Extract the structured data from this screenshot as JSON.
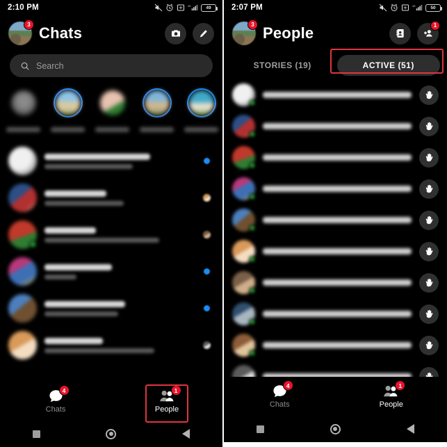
{
  "meta": {
    "accent_blue": "#1878f3",
    "badge_red": "#e8142a",
    "annotation_red": "#e0353f",
    "online_green": "#2ecc40",
    "background": "#000000"
  },
  "left_panel": {
    "status_bar": {
      "time": "2:10 PM",
      "battery_level": "49",
      "network": "4G",
      "icons": [
        "mute-icon",
        "alarm-icon",
        "screenshot-icon",
        "signal-icon",
        "battery-icon"
      ]
    },
    "header": {
      "title": "Chats",
      "avatar_badge": "3",
      "camera_label": "Camera",
      "compose_label": "New message"
    },
    "search": {
      "placeholder": "Search"
    },
    "stories": [
      {
        "name": "Your story",
        "has_ring": false
      },
      {
        "name": "Story 2",
        "has_ring": true
      },
      {
        "name": "Story 3",
        "has_ring": false
      },
      {
        "name": "Story 4",
        "has_ring": true
      },
      {
        "name": "Story 5",
        "has_ring": true
      }
    ],
    "chats": [
      {
        "avatar": "av-1",
        "online": false,
        "unread": true,
        "name_w": "72%",
        "msg_w": "60%"
      },
      {
        "avatar": "av-2",
        "online": false,
        "unread": false,
        "name_w": "42%",
        "msg_w": "54%"
      },
      {
        "avatar": "av-3",
        "online": true,
        "unread": false,
        "name_w": "35%",
        "msg_w": "78%"
      },
      {
        "avatar": "av-4",
        "online": false,
        "unread": true,
        "name_w": "46%",
        "msg_w": "22%"
      },
      {
        "avatar": "av-5",
        "online": false,
        "unread": true,
        "name_w": "55%",
        "msg_w": "50%"
      },
      {
        "avatar": "av-6",
        "online": false,
        "unread": false,
        "name_w": "40%",
        "msg_w": "75%"
      }
    ],
    "bottom_nav": [
      {
        "label": "Chats",
        "badge": "4",
        "selected": false,
        "icon": "chat-bubble-icon"
      },
      {
        "label": "People",
        "badge": "1",
        "selected": true,
        "icon": "people-icon"
      }
    ],
    "system_nav": [
      "recents-square-icon",
      "home-circle-icon",
      "back-triangle-icon"
    ]
  },
  "right_panel": {
    "status_bar": {
      "time": "2:07 PM",
      "battery_level": "50",
      "network": "4G",
      "icons": [
        "mute-icon",
        "alarm-icon",
        "screenshot-icon",
        "signal-icon",
        "battery-icon"
      ]
    },
    "header": {
      "title": "People",
      "avatar_badge": "3",
      "contacts_label": "Contacts",
      "add_person_label": "Add person",
      "add_person_badge": "1"
    },
    "tabs": [
      {
        "label": "STORIES (19)",
        "active": false
      },
      {
        "label": "ACTIVE (51)",
        "active": true
      }
    ],
    "people": [
      {
        "avatar": "pav-1",
        "online": true,
        "name_w": "38%"
      },
      {
        "avatar": "pav-2",
        "online": true,
        "name_w": "44%"
      },
      {
        "avatar": "pav-3",
        "online": true,
        "name_w": "88%"
      },
      {
        "avatar": "pav-4",
        "online": true,
        "name_w": "26%"
      },
      {
        "avatar": "pav-5",
        "online": true,
        "name_w": "41%"
      },
      {
        "avatar": "pav-6",
        "online": true,
        "name_w": "33%"
      },
      {
        "avatar": "pav-7",
        "online": true,
        "name_w": "30%"
      },
      {
        "avatar": "pav-8",
        "online": true,
        "name_w": "36%"
      },
      {
        "avatar": "pav-9",
        "online": true,
        "name_w": "47%"
      },
      {
        "avatar": "pav-10",
        "online": true,
        "name_w": "35%"
      }
    ],
    "wave_label": "Wave",
    "bottom_nav": [
      {
        "label": "Chats",
        "badge": "4",
        "selected": false,
        "icon": "chat-bubble-icon"
      },
      {
        "label": "People",
        "badge": "1",
        "selected": true,
        "icon": "people-icon"
      }
    ],
    "system_nav": [
      "recents-square-icon",
      "home-circle-icon",
      "back-triangle-icon"
    ]
  }
}
